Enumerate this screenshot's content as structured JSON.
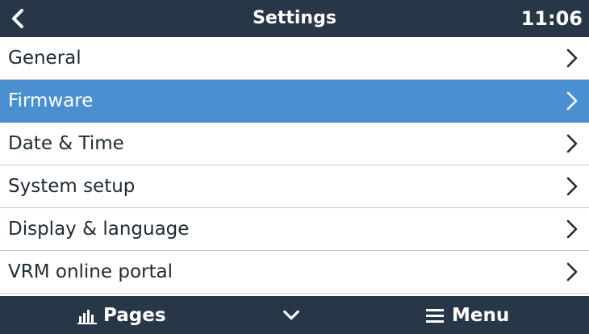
{
  "header": {
    "title": "Settings",
    "time": "11:06",
    "back_icon": "chevron-left-icon"
  },
  "settings": {
    "items": [
      {
        "label": "General",
        "selected": false
      },
      {
        "label": "Firmware",
        "selected": true
      },
      {
        "label": "Date & Time",
        "selected": false
      },
      {
        "label": "System setup",
        "selected": false
      },
      {
        "label": "Display & language",
        "selected": false
      },
      {
        "label": "VRM online portal",
        "selected": false
      }
    ]
  },
  "footer": {
    "pages_label": "Pages",
    "menu_label": "Menu",
    "pages_icon": "bar-chart-icon",
    "scroll_icon": "chevron-down-icon",
    "menu_icon": "hamburger-menu-icon"
  },
  "colors": {
    "header_bg": "#283747",
    "selected_bg": "#4a8fd0",
    "text": "#1f2a33"
  }
}
